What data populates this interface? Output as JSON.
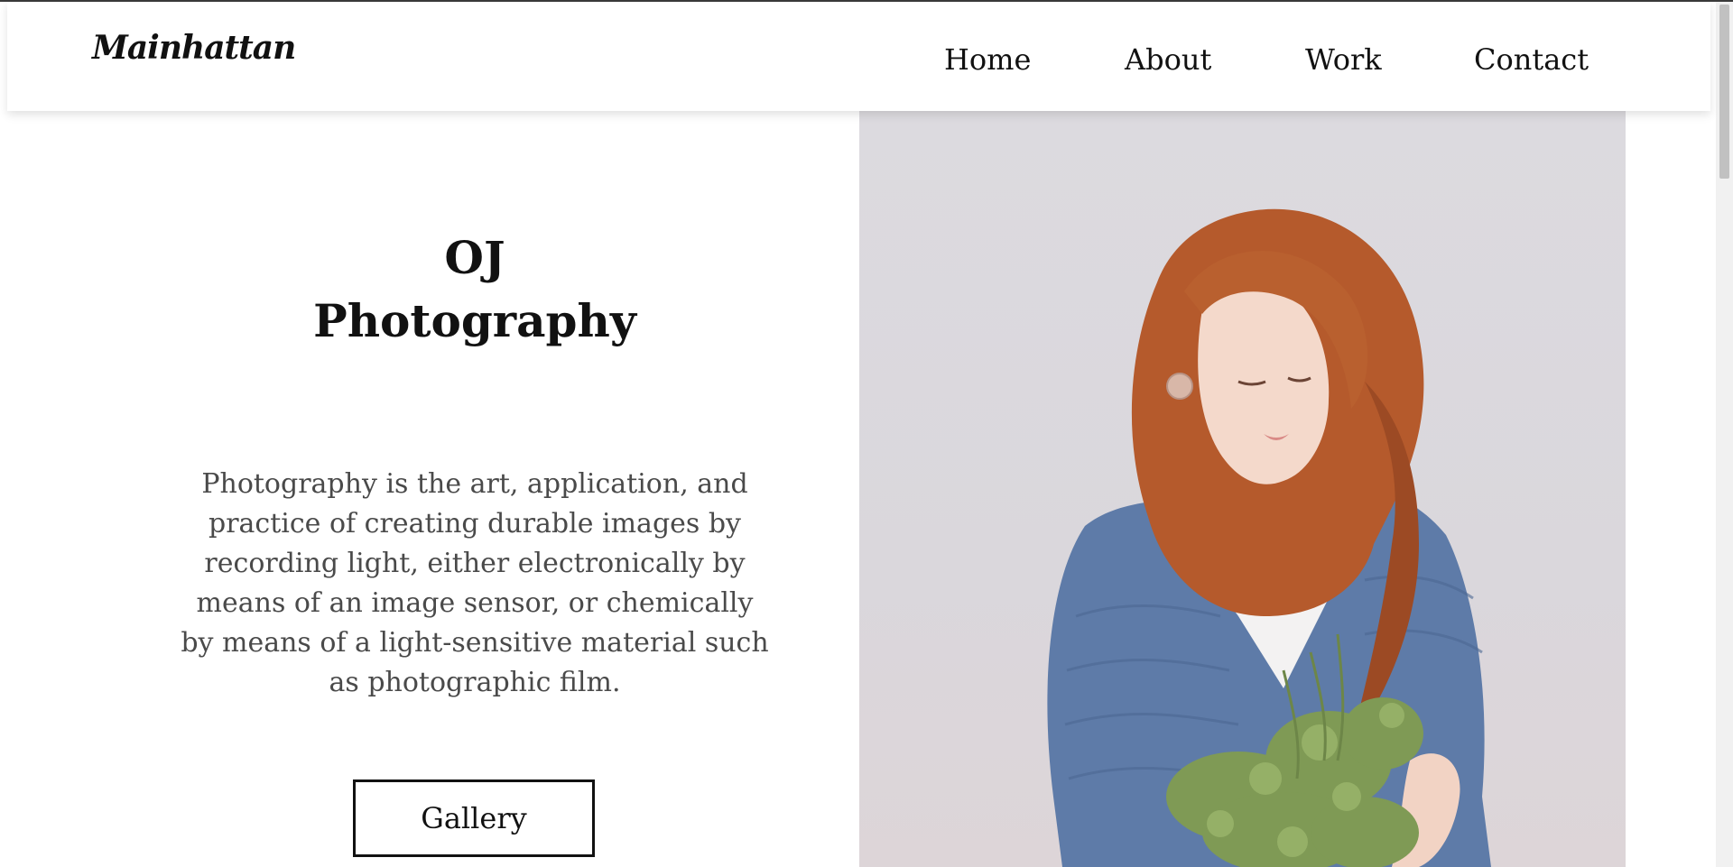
{
  "header": {
    "logo": "Mainhattan",
    "nav": {
      "home": "Home",
      "about": "About",
      "work": "Work",
      "contact": "Contact"
    }
  },
  "hero": {
    "title_line1": "OJ",
    "title_line2": "Photography",
    "description": "Photography is the art, application, and practice of creating durable images by recording light, either electronically by means of an image sensor, or chemically by means of a light-sensitive material such as photographic film.",
    "button_label": "Gallery",
    "image_alt": "woman-with-red-hair-holding-flowers"
  },
  "colors": {
    "text": "#111111",
    "body_text": "#4a4a4a",
    "image_background": "#dcdadf",
    "hair": "#b55a2c",
    "sweater": "#5e7ba8",
    "greenery": "#7f9a55"
  }
}
